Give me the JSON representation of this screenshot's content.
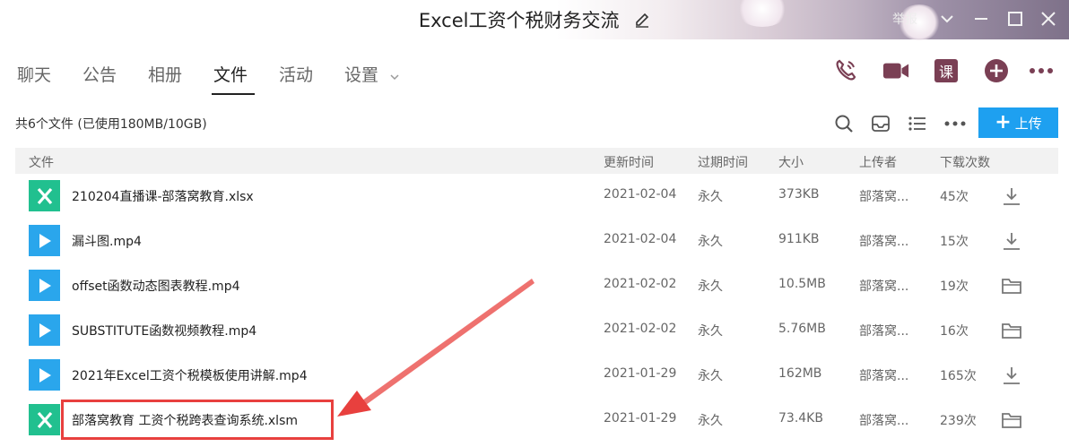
{
  "window": {
    "title": "Excel工资个税财务交流",
    "report_label": "举报"
  },
  "tabs": [
    {
      "label": "聊天",
      "active": false
    },
    {
      "label": "公告",
      "active": false
    },
    {
      "label": "相册",
      "active": false
    },
    {
      "label": "文件",
      "active": true
    },
    {
      "label": "活动",
      "active": false
    },
    {
      "label": "设置",
      "active": false
    }
  ],
  "toolbar_icons": [
    "phone-icon",
    "video-icon",
    "course-icon",
    "add-icon",
    "more-icon"
  ],
  "course_icon_text": "课",
  "files": {
    "summary": "共6个文件 (已使用180MB/10GB)",
    "upload_label": "上传",
    "columns": [
      "文件",
      "更新时间",
      "过期时间",
      "大小",
      "上传者",
      "下载次数"
    ],
    "rows": [
      {
        "type": "xlsx",
        "name": "210204直播课-部落窝教育.xlsx",
        "updated": "2021-02-04",
        "expires": "永久",
        "size": "373KB",
        "uploader": "部落窝...",
        "downloads": "45次",
        "action": "download-icon"
      },
      {
        "type": "video",
        "name": "漏斗图.mp4",
        "updated": "2021-02-04",
        "expires": "永久",
        "size": "911KB",
        "uploader": "部落窝...",
        "downloads": "15次",
        "action": "download-icon"
      },
      {
        "type": "video",
        "name": "offset函数动态图表教程.mp4",
        "updated": "2021-02-02",
        "expires": "永久",
        "size": "10.5MB",
        "uploader": "部落窝...",
        "downloads": "19次",
        "action": "folder-icon"
      },
      {
        "type": "video",
        "name": "SUBSTITUTE函数视频教程.mp4",
        "updated": "2021-02-02",
        "expires": "永久",
        "size": "5.76MB",
        "uploader": "部落窝...",
        "downloads": "16次",
        "action": "folder-icon"
      },
      {
        "type": "video",
        "name": "2021年Excel工资个税模板使用讲解.mp4",
        "updated": "2021-01-29",
        "expires": "永久",
        "size": "162MB",
        "uploader": "部落窝...",
        "downloads": "165次",
        "action": "download-icon"
      },
      {
        "type": "xlsx",
        "name": "部落窝教育  工资个税跨表查询系统.xlsm",
        "updated": "2021-01-29",
        "expires": "永久",
        "size": "73.4KB",
        "uploader": "部落窝...",
        "downloads": "239次",
        "action": "folder-icon"
      }
    ]
  },
  "colors": {
    "accent": "#1ea0f0",
    "xls_icon": "#21c08f",
    "video_icon": "#2aa6ec",
    "toolbar_icon": "#7a3f54",
    "annotation": "#e8403e"
  }
}
